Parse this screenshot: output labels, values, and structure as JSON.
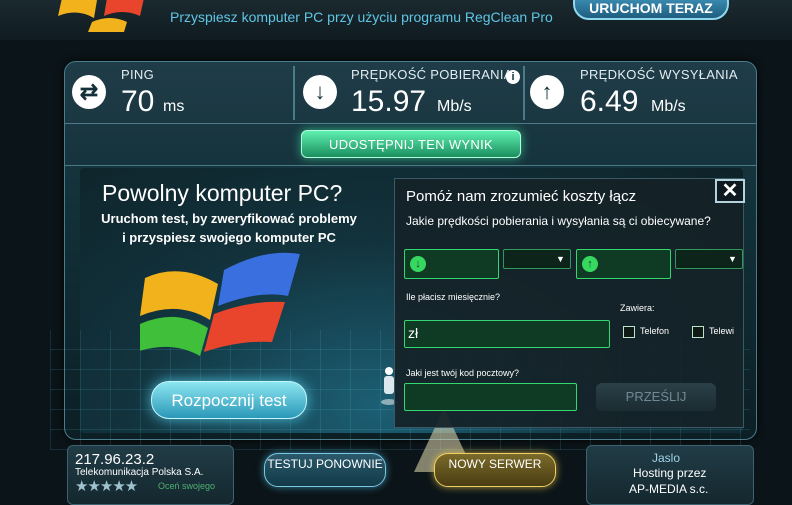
{
  "banner": {
    "text": "Przyspiesz komputer PC przy użyciu programu RegClean Pro",
    "button": "URUCHOM TERAZ"
  },
  "metrics": {
    "ping": {
      "label": "PING",
      "value": "70",
      "unit": "ms"
    },
    "download": {
      "label": "PRĘDKOŚĆ POBIERANIA",
      "value": "15.97",
      "unit": "Mb/s"
    },
    "upload": {
      "label": "PRĘDKOŚĆ WYSYŁANIA",
      "value": "6.49",
      "unit": "Mb/s"
    }
  },
  "share_button": "UDOSTĘPNIJ TEN WYNIK",
  "ad": {
    "title": "Powolny komputer PC?",
    "subtitle": "Uruchom test, by zweryfikować problemy i przyspiesz swojego komputer PC",
    "button": "Rozpocznij test"
  },
  "survey": {
    "title": "Pomóż nam zrozumieć koszty łącz",
    "question_speed": "Jakie prędkości pobierania i wysyłania są ci obiecywane?",
    "question_price": "Ile płacisz miesięcznie?",
    "price_prefix": "zł",
    "includes_label": "Zawiera:",
    "option_phone": "Telefon",
    "option_tv": "Telewi",
    "question_postal": "Jaki jest twój kod pocztowy?",
    "send_button": "PRZEŚLIJ"
  },
  "footer": {
    "ip": "217.96.23.2",
    "isp": "Telekomunikacja Polska S.A.",
    "rate_text": "Oceń swojego",
    "stars": "★★★★★",
    "retest_button": "TESTUJ PONOWNIE",
    "new_server_button": "NOWY SERWER",
    "server_city": "Jaslo",
    "server_hosting": "Hosting przez",
    "server_org": "AP-MEDIA s.c."
  },
  "icons": {
    "ping": "⇄",
    "download": "↓",
    "upload": "↑",
    "info": "i",
    "close": "✕",
    "select": "▼"
  },
  "colors": {
    "accent_green": "#33d870",
    "accent_cyan": "#5fc6e6",
    "panel_bg": "#123038"
  }
}
